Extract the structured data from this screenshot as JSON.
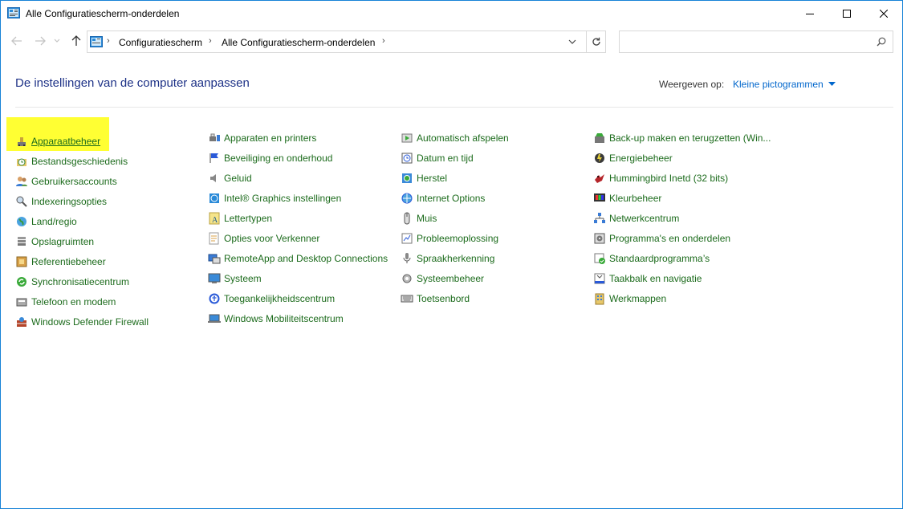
{
  "window": {
    "title": "Alle Configuratiescherm-onderdelen"
  },
  "address": {
    "crumbs": [
      "Configuratiescherm",
      "Alle Configuratiescherm-onderdelen"
    ],
    "search_placeholder": ""
  },
  "header": {
    "title": "De instellingen van de computer aanpassen",
    "view_label": "Weergeven op:",
    "view_value": "Kleine pictogrammen"
  },
  "columns": [
    [
      {
        "label": "Apparaatbeheer",
        "icon": "device-manager-icon",
        "highlighted": true
      },
      {
        "label": "Bestandsgeschiedenis",
        "icon": "file-history-icon"
      },
      {
        "label": "Gebruikersaccounts",
        "icon": "user-accounts-icon"
      },
      {
        "label": "Indexeringsopties",
        "icon": "indexing-options-icon"
      },
      {
        "label": "Land/regio",
        "icon": "region-globe-icon"
      },
      {
        "label": "Opslagruimten",
        "icon": "storage-spaces-icon"
      },
      {
        "label": "Referentiebeheer",
        "icon": "credential-manager-icon"
      },
      {
        "label": "Synchronisatiecentrum",
        "icon": "sync-center-icon"
      },
      {
        "label": "Telefoon en modem",
        "icon": "phone-modem-icon"
      },
      {
        "label": "Windows Defender Firewall",
        "icon": "firewall-icon"
      }
    ],
    [
      {
        "label": "Apparaten en printers",
        "icon": "devices-printers-icon"
      },
      {
        "label": "Beveiliging en onderhoud",
        "icon": "security-flag-icon"
      },
      {
        "label": "Geluid",
        "icon": "speaker-icon"
      },
      {
        "label": "Intel® Graphics instellingen",
        "icon": "intel-graphics-icon"
      },
      {
        "label": "Lettertypen",
        "icon": "fonts-icon"
      },
      {
        "label": "Opties voor Verkenner",
        "icon": "folder-options-icon"
      },
      {
        "label": "RemoteApp and Desktop Connections",
        "icon": "remoteapp-icon"
      },
      {
        "label": "Systeem",
        "icon": "system-monitor-icon"
      },
      {
        "label": "Toegankelijkheidscentrum",
        "icon": "ease-of-access-icon"
      },
      {
        "label": "Windows Mobiliteitscentrum",
        "icon": "mobility-center-icon"
      }
    ],
    [
      {
        "label": "Automatisch afspelen",
        "icon": "autoplay-icon"
      },
      {
        "label": "Datum en tijd",
        "icon": "date-time-icon"
      },
      {
        "label": "Herstel",
        "icon": "recovery-icon"
      },
      {
        "label": "Internet Options",
        "icon": "internet-options-icon"
      },
      {
        "label": "Muis",
        "icon": "mouse-icon"
      },
      {
        "label": "Probleemoplossing",
        "icon": "troubleshooting-icon"
      },
      {
        "label": "Spraakherkenning",
        "icon": "speech-recognition-icon"
      },
      {
        "label": "Systeembeheer",
        "icon": "administrative-tools-icon"
      },
      {
        "label": "Toetsenbord",
        "icon": "keyboard-icon"
      }
    ],
    [
      {
        "label": "Back-up maken en terugzetten (Win...",
        "icon": "backup-restore-icon"
      },
      {
        "label": "Energiebeheer",
        "icon": "power-options-icon"
      },
      {
        "label": "Hummingbird Inetd (32 bits)",
        "icon": "hummingbird-icon"
      },
      {
        "label": "Kleurbeheer",
        "icon": "color-management-icon"
      },
      {
        "label": "Netwerkcentrum",
        "icon": "network-center-icon"
      },
      {
        "label": "Programma's en onderdelen",
        "icon": "programs-features-icon"
      },
      {
        "label": "Standaardprogramma’s",
        "icon": "default-programs-icon"
      },
      {
        "label": "Taakbalk en navigatie",
        "icon": "taskbar-icon"
      },
      {
        "label": "Werkmappen",
        "icon": "work-folders-icon"
      }
    ]
  ]
}
